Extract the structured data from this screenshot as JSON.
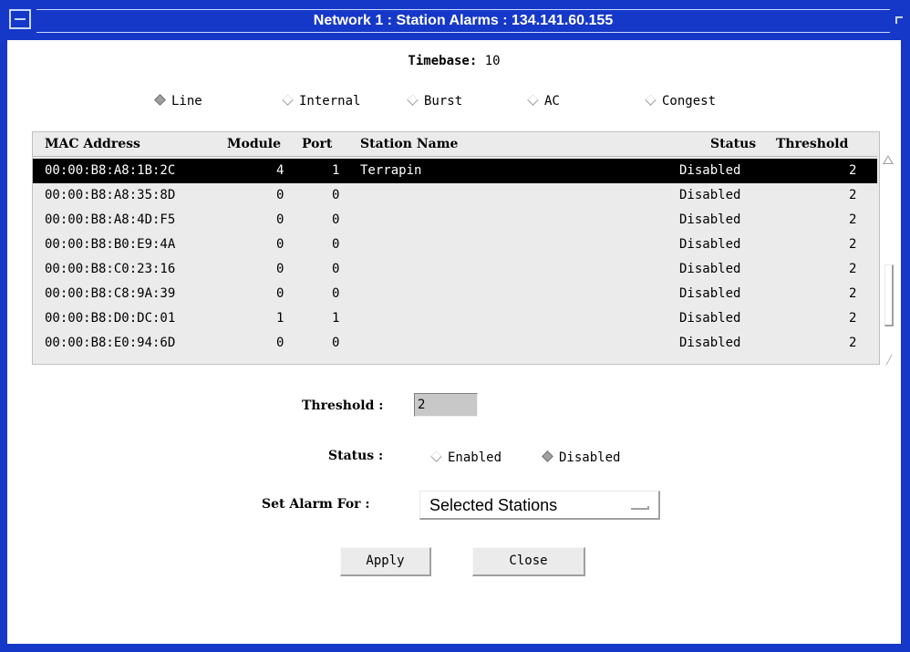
{
  "window": {
    "title": "Network 1 : Station Alarms : 134.141.60.155"
  },
  "timebase": {
    "label": "Timebase:",
    "value": "10"
  },
  "alarm_types": [
    {
      "label": "Line",
      "selected": true
    },
    {
      "label": "Internal",
      "selected": false
    },
    {
      "label": "Burst",
      "selected": false
    },
    {
      "label": "AC",
      "selected": false
    },
    {
      "label": "Congest",
      "selected": false
    }
  ],
  "table": {
    "headers": {
      "mac": "MAC Address",
      "module": "Module",
      "port": "Port",
      "name": "Station Name",
      "status": "Status",
      "threshold": "Threshold"
    },
    "rows": [
      {
        "mac": "00:00:B8:A8:1B:2C",
        "module": "4",
        "port": "1",
        "name": "Terrapin",
        "status": "Disabled",
        "threshold": "2",
        "selected": true
      },
      {
        "mac": "00:00:B8:A8:35:8D",
        "module": "0",
        "port": "0",
        "name": "",
        "status": "Disabled",
        "threshold": "2",
        "selected": false
      },
      {
        "mac": "00:00:B8:A8:4D:F5",
        "module": "0",
        "port": "0",
        "name": "",
        "status": "Disabled",
        "threshold": "2",
        "selected": false
      },
      {
        "mac": "00:00:B8:B0:E9:4A",
        "module": "0",
        "port": "0",
        "name": "",
        "status": "Disabled",
        "threshold": "2",
        "selected": false
      },
      {
        "mac": "00:00:B8:C0:23:16",
        "module": "0",
        "port": "0",
        "name": "",
        "status": "Disabled",
        "threshold": "2",
        "selected": false
      },
      {
        "mac": "00:00:B8:C8:9A:39",
        "module": "0",
        "port": "0",
        "name": "",
        "status": "Disabled",
        "threshold": "2",
        "selected": false
      },
      {
        "mac": "00:00:B8:D0:DC:01",
        "module": "1",
        "port": "1",
        "name": "",
        "status": "Disabled",
        "threshold": "2",
        "selected": false
      },
      {
        "mac": "00:00:B8:E0:94:6D",
        "module": "0",
        "port": "0",
        "name": "",
        "status": "Disabled",
        "threshold": "2",
        "selected": false
      }
    ]
  },
  "form": {
    "threshold_label": "Threshold :",
    "threshold_value": "2",
    "status_label": "Status :",
    "status_options": [
      {
        "label": "Enabled",
        "selected": false
      },
      {
        "label": "Disabled",
        "selected": true
      }
    ],
    "set_alarm_label": "Set Alarm For :",
    "set_alarm_value": "Selected Stations"
  },
  "buttons": {
    "apply": "Apply",
    "close": "Close"
  },
  "colors": {
    "titlebar": "#1638c8",
    "selected_row": "#000000",
    "panel": "#ebebeb"
  }
}
